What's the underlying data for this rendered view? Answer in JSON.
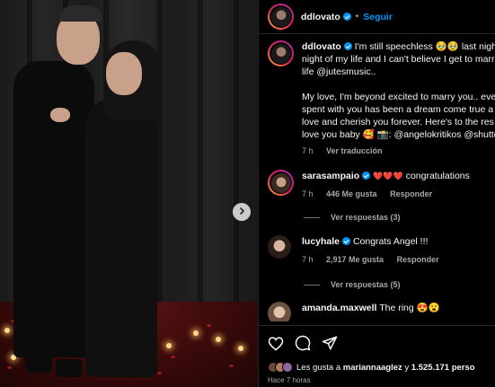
{
  "post": {
    "author": "ddlovato",
    "follow_label": "Seguir",
    "dot": "•"
  },
  "caption": {
    "author": "ddlovato",
    "line1": "I'm still speechless 🥹🥹 last night",
    "line2": "night of my life and I can't believe I get to marr",
    "line3": "life @jutesmusic..",
    "line4": "My love, I'm beyond excited to marry you.. eve",
    "line5": "spent with you has been a dream come true a",
    "line6": "love and cherish you forever. Here's to the res",
    "line7": "love you baby 🥰 📸: @angelokritikos @shutte",
    "time": "7 h",
    "translate": "Ver traducción"
  },
  "comments": [
    {
      "user": "sarasampaio",
      "text": "congratulations",
      "hearts": "❤️❤️❤️",
      "time": "7 h",
      "likes": "446 Me gusta",
      "reply": "Responder",
      "view_replies": "Ver respuestas (3)"
    },
    {
      "user": "lucyhale",
      "text": "Congrats Angel !!!",
      "time": "7 h",
      "likes": "2,917 Me gusta",
      "reply": "Responder",
      "view_replies": "Ver respuestas (5)"
    },
    {
      "user": "amanda.maxwell",
      "text": "The ring 😍😮"
    }
  ],
  "likes": {
    "prefix": "Les gusta a",
    "user": "mariannaaglez",
    "joiner": "y",
    "count": "1.525.171 perso"
  },
  "post_time": "Hace 7 horas",
  "colors": {
    "accent": "#0095f6",
    "background": "#000000",
    "muted": "#a8a8a8"
  },
  "icons": [
    "heart-icon",
    "comment-icon",
    "share-icon",
    "chevron-right-icon",
    "verified-icon"
  ]
}
